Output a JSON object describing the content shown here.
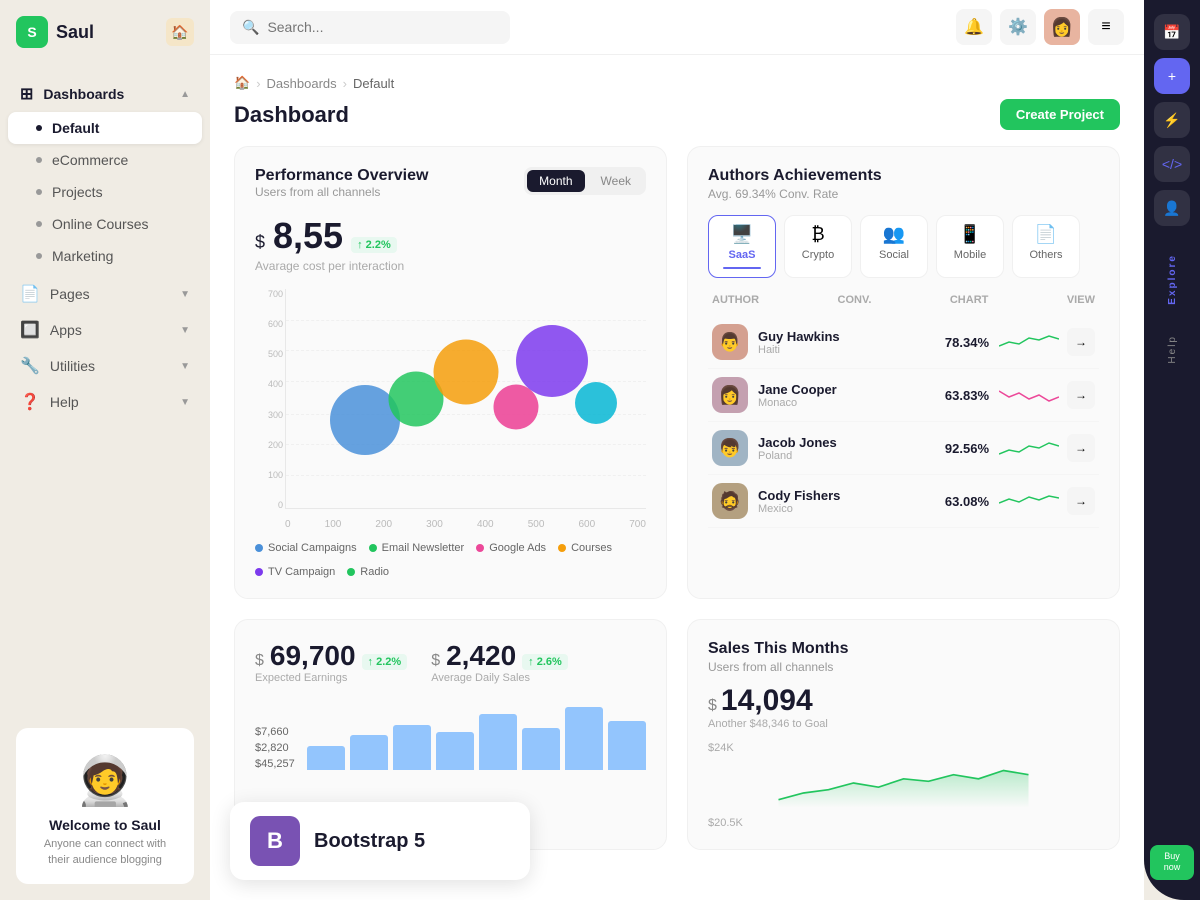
{
  "app": {
    "name": "Saul",
    "logo_letter": "S"
  },
  "sidebar": {
    "nav_items": [
      {
        "id": "dashboards",
        "label": "Dashboards",
        "type": "group",
        "icon": "grid",
        "arrow": true
      },
      {
        "id": "default",
        "label": "Default",
        "type": "sub",
        "active": true
      },
      {
        "id": "ecommerce",
        "label": "eCommerce",
        "type": "sub"
      },
      {
        "id": "projects",
        "label": "Projects",
        "type": "sub"
      },
      {
        "id": "online-courses",
        "label": "Online Courses",
        "type": "sub"
      },
      {
        "id": "marketing",
        "label": "Marketing",
        "type": "sub"
      },
      {
        "id": "pages",
        "label": "Pages",
        "type": "group",
        "icon": "page",
        "arrow": true
      },
      {
        "id": "apps",
        "label": "Apps",
        "type": "group",
        "icon": "app",
        "arrow": true
      },
      {
        "id": "utilities",
        "label": "Utilities",
        "type": "group",
        "icon": "tool",
        "arrow": true
      },
      {
        "id": "help",
        "label": "Help",
        "type": "group",
        "icon": "help",
        "arrow": true
      }
    ],
    "welcome": {
      "title": "Welcome to Saul",
      "subtitle": "Anyone can connect with their audience blogging"
    }
  },
  "topbar": {
    "search_placeholder": "Search...",
    "search_value": "Search _"
  },
  "breadcrumb": {
    "home": "🏠",
    "dashboards": "Dashboards",
    "current": "Default"
  },
  "page": {
    "title": "Dashboard",
    "create_btn": "Create Project"
  },
  "performance": {
    "title": "Performance Overview",
    "subtitle": "Users from all channels",
    "tab_month": "Month",
    "tab_week": "Week",
    "amount": "8,55",
    "currency": "$",
    "badge": "↑ 2.2%",
    "cost_label": "Avarage cost per interaction",
    "bubbles": [
      {
        "x": 22,
        "y": 55,
        "size": 70,
        "color": "#4a90d9"
      },
      {
        "x": 35,
        "y": 48,
        "size": 55,
        "color": "#22c55e"
      },
      {
        "x": 48,
        "y": 40,
        "size": 62,
        "color": "#f59e0b"
      },
      {
        "x": 62,
        "y": 50,
        "size": 45,
        "color": "#ec4899"
      },
      {
        "x": 73,
        "y": 42,
        "size": 72,
        "color": "#7c3aed"
      },
      {
        "x": 84,
        "y": 52,
        "size": 40,
        "color": "#06b6d4"
      }
    ],
    "y_labels": [
      "700",
      "600",
      "500",
      "400",
      "300",
      "200",
      "100",
      "0"
    ],
    "x_labels": [
      "0",
      "100",
      "200",
      "300",
      "400",
      "500",
      "600",
      "700"
    ],
    "legend": [
      {
        "label": "Social Campaigns",
        "color": "#4a90d9"
      },
      {
        "label": "Email Newsletter",
        "color": "#22c55e"
      },
      {
        "label": "Google Ads",
        "color": "#ec4899"
      },
      {
        "label": "Courses",
        "color": "#f59e0b"
      },
      {
        "label": "TV Campaign",
        "color": "#7c3aed"
      },
      {
        "label": "Radio",
        "color": "#22c55e"
      }
    ]
  },
  "earnings": {
    "expected": {
      "amount": "69,700",
      "currency": "$",
      "badge": "↑ 2.2%",
      "label": "Expected Earnings"
    },
    "daily": {
      "amount": "2,420",
      "currency": "$",
      "badge": "↑ 2.6%",
      "label": "Average Daily Sales"
    },
    "values": [
      "$7,660",
      "$2,820",
      "$45,257"
    ],
    "bars": [
      30,
      45,
      60,
      50,
      70,
      55,
      80,
      65
    ]
  },
  "authors": {
    "title": "Authors Achievements",
    "subtitle": "Avg. 69.34% Conv. Rate",
    "categories": [
      {
        "id": "saas",
        "label": "SaaS",
        "icon": "🖥️",
        "active": true
      },
      {
        "id": "crypto",
        "label": "Crypto",
        "icon": "₿"
      },
      {
        "id": "social",
        "label": "Social",
        "icon": "👥"
      },
      {
        "id": "mobile",
        "label": "Mobile",
        "icon": "📱"
      },
      {
        "id": "others",
        "label": "Others",
        "icon": "📄"
      }
    ],
    "col_headers": {
      "author": "AUTHOR",
      "conv": "CONV.",
      "chart": "CHART",
      "view": "VIEW"
    },
    "rows": [
      {
        "name": "Guy Hawkins",
        "country": "Haiti",
        "conv": "78.34%",
        "avatar": "👨",
        "sparkline_color": "#22c55e"
      },
      {
        "name": "Jane Cooper",
        "country": "Monaco",
        "conv": "63.83%",
        "avatar": "👩",
        "sparkline_color": "#ec4899"
      },
      {
        "name": "Jacob Jones",
        "country": "Poland",
        "conv": "92.56%",
        "avatar": "👦",
        "sparkline_color": "#22c55e"
      },
      {
        "name": "Cody Fishers",
        "country": "Mexico",
        "conv": "63.08%",
        "avatar": "🧔",
        "sparkline_color": "#22c55e"
      }
    ]
  },
  "sales": {
    "title": "Sales This Months",
    "subtitle": "Users from all channels",
    "amount": "14,094",
    "currency": "$",
    "goal_label": "Another $48,346 to Goal",
    "y_labels": [
      "$24K",
      "$20.5K"
    ]
  },
  "right_panel": {
    "btns": [
      "📅",
      "+",
      "⚡",
      "</>",
      "👤"
    ],
    "side_labels": [
      "Explore",
      "Help",
      "Buy now"
    ]
  },
  "bootstrap": {
    "letter": "B",
    "text": "Bootstrap 5"
  }
}
